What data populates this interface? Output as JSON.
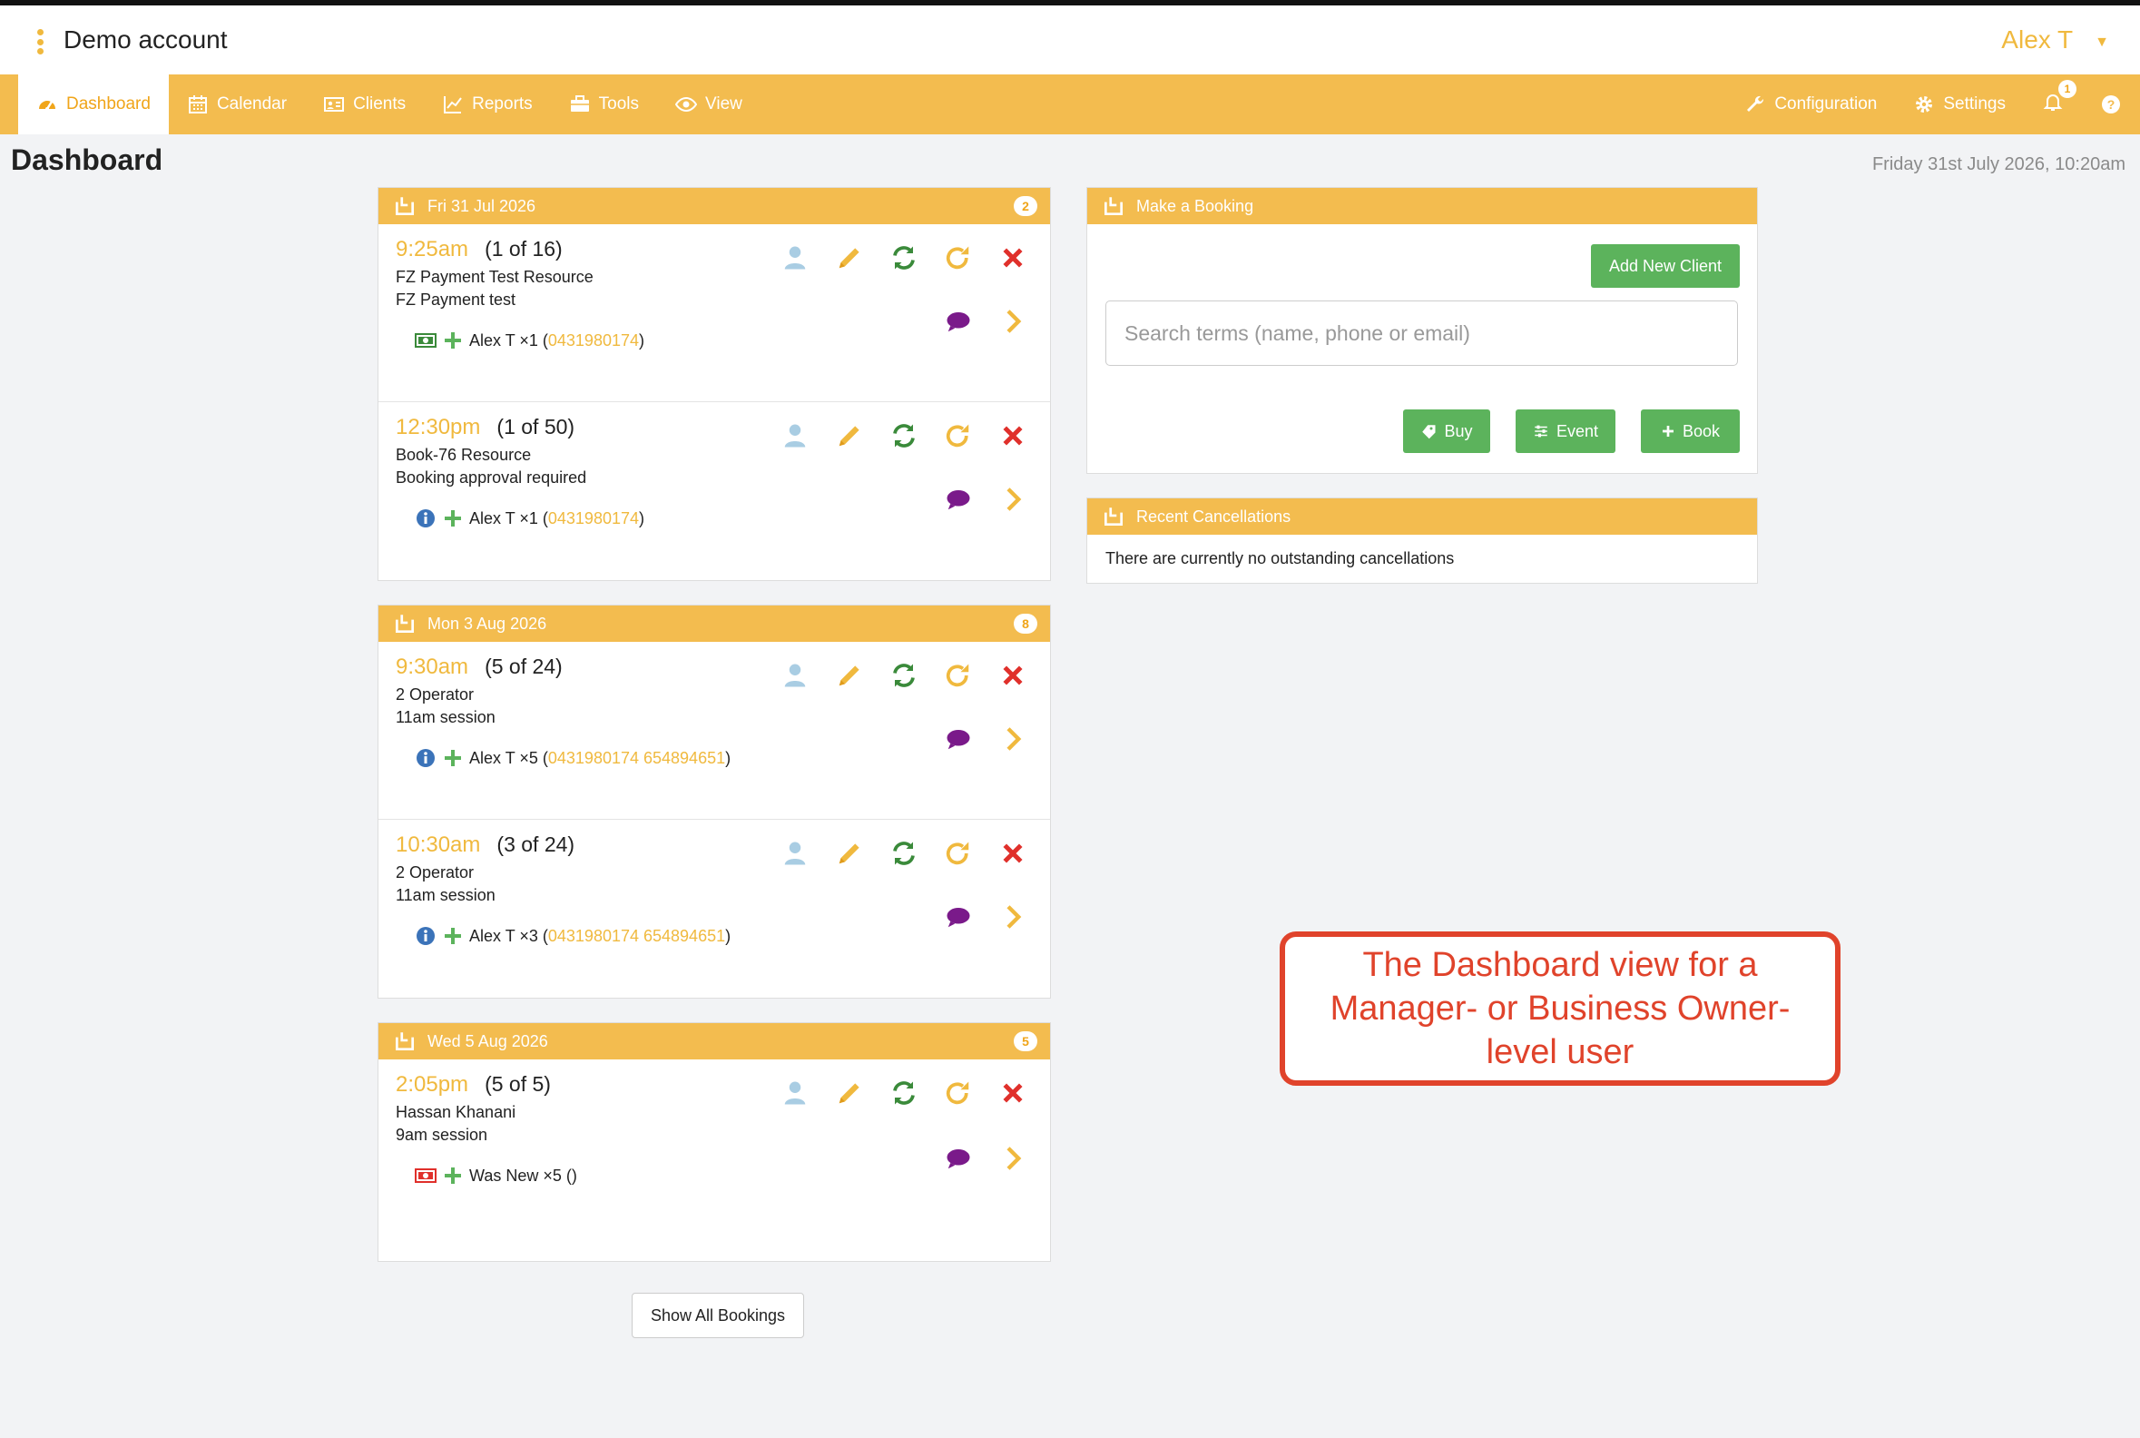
{
  "header": {
    "account_name": "Demo account",
    "user_name": "Alex T"
  },
  "nav": {
    "left": [
      {
        "label": "Dashboard",
        "icon": "dashboard-icon",
        "active": true
      },
      {
        "label": "Calendar",
        "icon": "calendar-icon"
      },
      {
        "label": "Clients",
        "icon": "clients-icon"
      },
      {
        "label": "Reports",
        "icon": "reports-icon"
      },
      {
        "label": "Tools",
        "icon": "tools-icon"
      },
      {
        "label": "View",
        "icon": "eye-icon"
      }
    ],
    "right": [
      {
        "label": "Configuration",
        "icon": "wrench-icon"
      },
      {
        "label": "Settings",
        "icon": "gear-icon"
      }
    ],
    "notification_count": "1"
  },
  "page": {
    "title": "Dashboard",
    "datetime": "Friday 31st July 2026, 10:20am"
  },
  "days": [
    {
      "date": "Fri 31 Jul 2026",
      "count": "2",
      "bookings": [
        {
          "time": "9:25am",
          "count": "(1 of 16)",
          "line1": "FZ Payment Test Resource",
          "line2": "FZ Payment test",
          "client": "Alex T ×1 (",
          "phone": "0431980174",
          "close": ")",
          "status_icon": "cash-icon"
        },
        {
          "time": "12:30pm",
          "count": "(1 of 50)",
          "line1": "Book-76 Resource",
          "line2": "Booking approval required",
          "client": "Alex T ×1 (",
          "phone": "0431980174",
          "close": ")",
          "status_icon": "info-icon"
        }
      ]
    },
    {
      "date": "Mon 3 Aug 2026",
      "count": "8",
      "bookings": [
        {
          "time": "9:30am",
          "count": "(5 of 24)",
          "line1": "2 Operator",
          "line2": "11am session",
          "client": "Alex T ×5 (",
          "phone": "0431980174 654894651",
          "close": ")",
          "status_icon": "info-icon"
        },
        {
          "time": "10:30am",
          "count": "(3 of 24)",
          "line1": "2 Operator",
          "line2": "11am session",
          "client": "Alex T ×3 (",
          "phone": "0431980174 654894651",
          "close": ")",
          "status_icon": "info-icon"
        }
      ]
    },
    {
      "date": "Wed 5 Aug 2026",
      "count": "5",
      "bookings": [
        {
          "time": "2:05pm",
          "count": "(5 of 5)",
          "line1": "Hassan Khanani",
          "line2": "9am session",
          "client": "Was New ×5 (",
          "phone": "",
          "close": ")",
          "status_icon": "cash-unpaid-icon"
        }
      ]
    }
  ],
  "booking_panel": {
    "title": "Make a Booking",
    "add_client": "Add New Client",
    "search_placeholder": "Search terms (name, phone or email)",
    "buy": "Buy",
    "event": "Event",
    "book": "Book"
  },
  "cancellations": {
    "title": "Recent Cancellations",
    "text": "There are currently no outstanding cancellations"
  },
  "show_all": "Show All Bookings",
  "callout": "The Dashboard view for a Manager- or Business Owner-level user",
  "colors": {
    "accent": "#f3bc4f",
    "green": "#5cb35c",
    "callout": "#e0432b"
  }
}
